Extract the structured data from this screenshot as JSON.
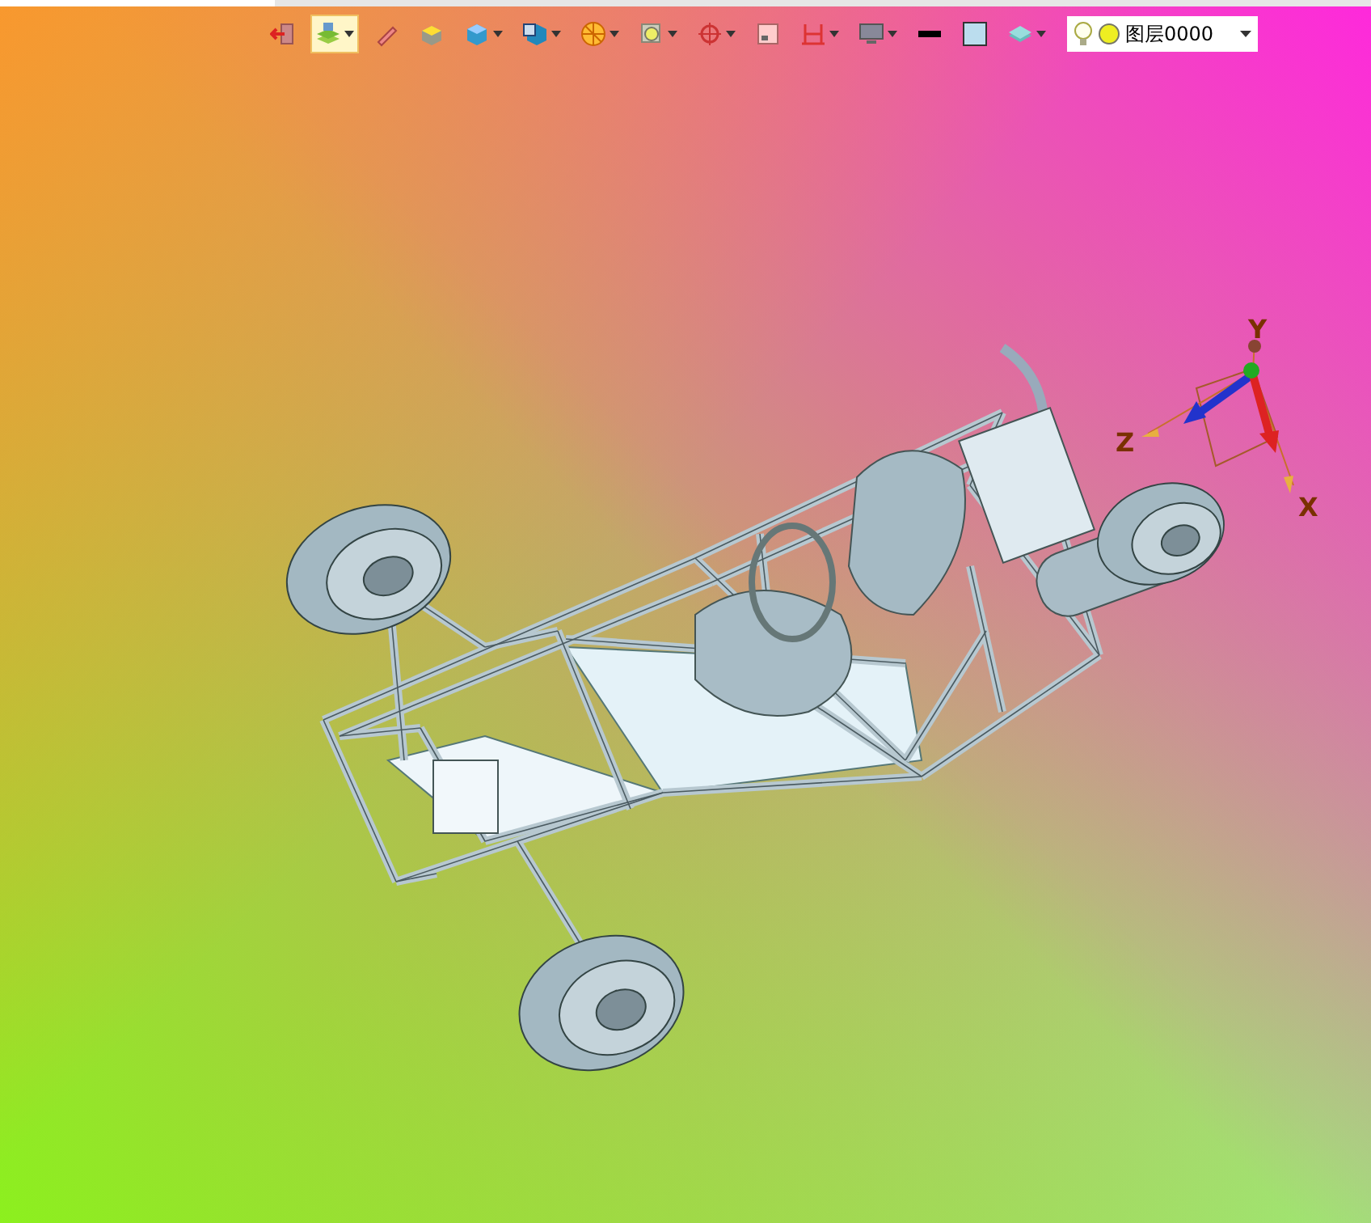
{
  "toolbar": {
    "buttons": [
      {
        "kind": "exit",
        "dropdown": false,
        "selected": false
      },
      {
        "kind": "layer-display",
        "dropdown": true,
        "selected": true
      },
      {
        "kind": "pen",
        "dropdown": false,
        "selected": false
      },
      {
        "kind": "box-face",
        "dropdown": false,
        "selected": false
      },
      {
        "kind": "cube",
        "dropdown": true,
        "selected": false
      },
      {
        "kind": "cube-view",
        "dropdown": true,
        "selected": false
      },
      {
        "kind": "sphere",
        "dropdown": true,
        "selected": false
      },
      {
        "kind": "zoom",
        "dropdown": true,
        "selected": false
      },
      {
        "kind": "target",
        "dropdown": true,
        "selected": false
      },
      {
        "kind": "frame",
        "dropdown": false,
        "selected": false
      },
      {
        "kind": "dimension",
        "dropdown": true,
        "selected": false
      },
      {
        "kind": "monitor",
        "dropdown": true,
        "selected": false
      },
      {
        "kind": "line-color",
        "dropdown": false,
        "selected": false
      },
      {
        "kind": "fill-color",
        "dropdown": false,
        "selected": false
      },
      {
        "kind": "layer-stack",
        "dropdown": true,
        "selected": false
      }
    ],
    "layer_combo": {
      "value": "图层0000"
    }
  },
  "axes": {
    "y_label": "Y",
    "z_label": "Z",
    "x_label": "X"
  }
}
